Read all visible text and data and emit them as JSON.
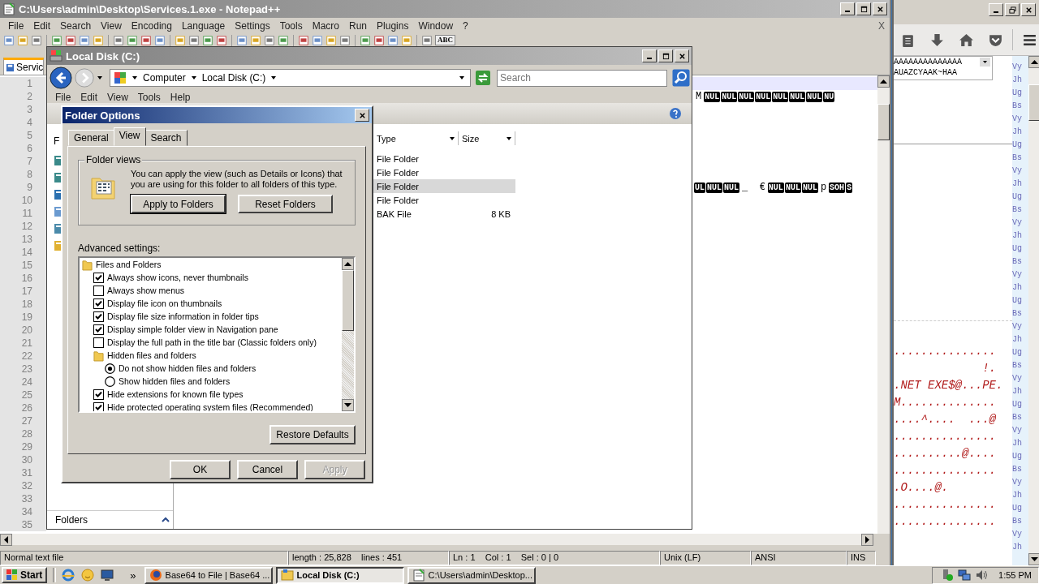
{
  "notepad": {
    "title": "C:\\Users\\admin\\Desktop\\Services.1.exe - Notepad++",
    "menu": [
      "File",
      "Edit",
      "Search",
      "View",
      "Encoding",
      "Language",
      "Settings",
      "Tools",
      "Macro",
      "Run",
      "Plugins",
      "Window",
      "?"
    ],
    "toolbar_text": "ABC",
    "close_doc": "X",
    "tab": {
      "label": "Servic",
      "selected": true
    },
    "lines": [
      {
        "number": "1",
        "current": true
      },
      {
        "number": "2",
        "current": false,
        "tokens": [
          {
            "kind": "plain",
            "text": "M"
          },
          {
            "kind": "control",
            "text": "NUL"
          },
          {
            "kind": "control",
            "text": "NUL"
          },
          {
            "kind": "control",
            "text": "NUL"
          },
          {
            "kind": "control",
            "text": "NUL"
          },
          {
            "kind": "control",
            "text": "NUL"
          },
          {
            "kind": "control",
            "text": "NUL"
          },
          {
            "kind": "control",
            "text": "NUL"
          },
          {
            "kind": "control",
            "text": "NU"
          }
        ]
      },
      {
        "number": "3",
        "current": false
      },
      {
        "number": "4",
        "current": false
      },
      {
        "number": "5",
        "current": false
      },
      {
        "number": "6",
        "current": false
      },
      {
        "number": "7",
        "current": false
      },
      {
        "number": "8",
        "current": false
      },
      {
        "number": "9",
        "current": false,
        "tokens": [
          {
            "kind": "control",
            "text": "UL"
          },
          {
            "kind": "control",
            "text": "NUL"
          },
          {
            "kind": "control",
            "text": "NUL"
          },
          {
            "kind": "plain",
            "text": "_  €"
          },
          {
            "kind": "control",
            "text": "NUL"
          },
          {
            "kind": "control",
            "text": "NUL"
          },
          {
            "kind": "control",
            "text": "NUL"
          },
          {
            "kind": "plain",
            "text": "p"
          },
          {
            "kind": "control",
            "text": "SOH"
          },
          {
            "kind": "control",
            "text": "S"
          }
        ]
      },
      {
        "number": "10",
        "current": false
      },
      {
        "number": "11",
        "current": false
      },
      {
        "number": "12",
        "current": false
      },
      {
        "number": "13",
        "current": false
      },
      {
        "number": "14",
        "current": false
      },
      {
        "number": "15",
        "current": false
      },
      {
        "number": "16",
        "current": false
      },
      {
        "number": "17",
        "current": false
      },
      {
        "number": "18",
        "current": false
      },
      {
        "number": "19",
        "current": false
      },
      {
        "number": "20",
        "current": false
      },
      {
        "number": "21",
        "current": false
      },
      {
        "number": "22",
        "current": false
      },
      {
        "number": "23",
        "current": false
      },
      {
        "number": "24",
        "current": false
      },
      {
        "number": "25",
        "current": false
      },
      {
        "number": "26",
        "current": false
      },
      {
        "number": "27",
        "current": false
      },
      {
        "number": "28",
        "current": false
      },
      {
        "number": "29",
        "current": false
      },
      {
        "number": "30",
        "current": false
      },
      {
        "number": "31",
        "current": false
      },
      {
        "number": "32",
        "current": false
      },
      {
        "number": "33",
        "current": false
      },
      {
        "number": "34",
        "current": false
      },
      {
        "number": "35",
        "current": false
      }
    ],
    "status": [
      "Normal text file",
      "length : 25,828    lines : 451",
      "Ln : 1    Col : 1    Sel : 0 | 0",
      "Unix (LF)",
      "ANSI",
      "INS"
    ]
  },
  "explorer": {
    "title": "Local Disk (C:)",
    "breadcrumbs": [
      "Computer",
      "Local Disk (C:)"
    ],
    "search": {
      "placeholder": "Search"
    },
    "menu": [
      "File",
      "Edit",
      "View",
      "Tools",
      "Help"
    ],
    "nav_label": "F",
    "nav_footer": "Folders",
    "columns": [
      "Type",
      "Size"
    ],
    "rows": [
      {
        "type": "File Folder",
        "selected": false
      },
      {
        "type": "File Folder",
        "selected": false
      },
      {
        "type": "File Folder",
        "selected": true
      },
      {
        "type": "File Folder",
        "selected": false
      },
      {
        "type": "BAK File",
        "size": "8 KB",
        "selected": false
      }
    ]
  },
  "dialog": {
    "title": "Folder Options",
    "tabs": [
      {
        "label": "General",
        "selected": false
      },
      {
        "label": "View",
        "selected": true
      },
      {
        "label": "Search",
        "selected": false
      }
    ],
    "group_title": "Folder views",
    "description": "You can apply the view (such as Details or Icons) that you are using for this folder to all folders of this type.",
    "group_buttons": [
      "Apply to Folders",
      "Reset Folders"
    ],
    "advanced_label": "Advanced settings:",
    "settings": [
      {
        "kind": "folder",
        "label": "Files and Folders",
        "children": [
          {
            "kind": "checkbox",
            "label": "Always show icons, never thumbnails",
            "checked": true
          },
          {
            "kind": "checkbox",
            "label": "Always show menus",
            "checked": false
          },
          {
            "kind": "checkbox",
            "label": "Display file icon on thumbnails",
            "checked": true
          },
          {
            "kind": "checkbox",
            "label": "Display file size information in folder tips",
            "checked": true
          },
          {
            "kind": "checkbox",
            "label": "Display simple folder view in Navigation pane",
            "checked": true
          },
          {
            "kind": "checkbox",
            "label": "Display the full path in the title bar (Classic folders only)",
            "checked": false
          },
          {
            "kind": "folder",
            "label": "Hidden files and folders",
            "children": [
              {
                "kind": "radio",
                "label": "Do not show hidden files and folders",
                "selected": true
              },
              {
                "kind": "radio",
                "label": "Show hidden files and folders",
                "selected": false
              }
            ]
          },
          {
            "kind": "checkbox",
            "label": "Hide extensions for known file types",
            "checked": true
          },
          {
            "kind": "checkbox",
            "label": "Hide protected operating system files (Recommended)",
            "checked": true
          }
        ]
      }
    ],
    "restore_button": "Restore Defaults",
    "buttons": [
      {
        "label": "OK",
        "disabled": false
      },
      {
        "label": "Cancel",
        "disabled": false
      },
      {
        "label": "Apply",
        "disabled": true
      }
    ]
  },
  "browser": {
    "field_lines": [
      "AAAAAAAAAAAAAA",
      "AUAZCYAAK~HAA"
    ],
    "dump_lines": [
      "...............",
      "             !.",
      ".NET EXE$@...PE.",
      "M..............",
      "....^....  ...@",
      "...............",
      "..........@....",
      "...............",
      ".O....@.",
      "...............",
      "..............."
    ],
    "side_strip": [
      "Vy",
      "Jh",
      "Ug",
      "Bs",
      "Vy",
      "Jh",
      "Ug",
      "Bs",
      "Vy",
      "Jh",
      "Ug",
      "Bs",
      "Vy",
      "Jh",
      "Ug",
      "Bs",
      "Vy",
      "Jh",
      "Ug",
      "Bs",
      "Vy",
      "Jh",
      "Ug",
      "Bs",
      "Vy",
      "Jh",
      "Ug",
      "Bs",
      "Vy",
      "Jh",
      "Ug",
      "Bs",
      "Vy",
      "Jh",
      "Ug",
      "Bs",
      "Vy",
      "Jh"
    ]
  },
  "taskbar": {
    "start": "Start",
    "overflow": "»",
    "tasks": [
      {
        "label": "Base64 to File | Base64 ...",
        "selected": false
      },
      {
        "label": "Local Disk (C:)",
        "selected": true
      },
      {
        "label": "C:\\Users\\admin\\Desktop...",
        "selected": false
      }
    ],
    "clock": "1:55 PM"
  }
}
